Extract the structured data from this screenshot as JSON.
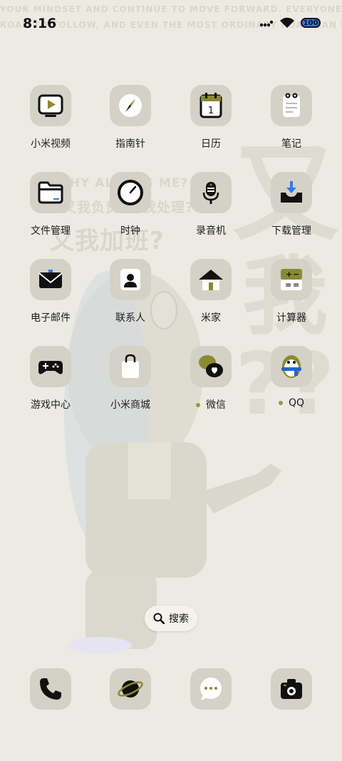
{
  "status_bar": {
    "time": "8:16",
    "battery": "100"
  },
  "wallpaper": {
    "lines": [
      "YOUR MINDSET AND CONTINUE TO MOVE FORWARD. EVERYONE HAS A",
      "ROAD TO FOLLOW, AND EVEN THE MOST ORDINARY ROAD CAN LEAD",
      "WHY ALWAYS ME?",
      "又我负责?又我处理?",
      "又我加班?"
    ],
    "big": [
      "又",
      "我",
      "?",
      "?"
    ]
  },
  "apps": [
    {
      "label": "小米视频",
      "icon": "video-play-icon"
    },
    {
      "label": "指南针",
      "icon": "compass-icon"
    },
    {
      "label": "日历",
      "icon": "calendar-icon",
      "badge": "1"
    },
    {
      "label": "笔记",
      "icon": "notes-icon"
    },
    {
      "label": "文件管理",
      "icon": "folder-icon"
    },
    {
      "label": "时钟",
      "icon": "clock-icon"
    },
    {
      "label": "录音机",
      "icon": "microphone-icon"
    },
    {
      "label": "下载管理",
      "icon": "download-icon"
    },
    {
      "label": "电子邮件",
      "icon": "mail-icon"
    },
    {
      "label": "联系人",
      "icon": "contacts-icon"
    },
    {
      "label": "米家",
      "icon": "home-icon"
    },
    {
      "label": "计算器",
      "icon": "calculator-icon"
    },
    {
      "label": "游戏中心",
      "icon": "gamepad-icon"
    },
    {
      "label": "小米商城",
      "icon": "shopping-bag-icon"
    },
    {
      "label": "微信",
      "icon": "wechat-icon",
      "dot": true
    },
    {
      "label": "QQ",
      "icon": "qq-penguin-icon",
      "dot": true
    }
  ],
  "search": {
    "label": "搜索"
  },
  "dock": [
    {
      "icon": "phone-icon"
    },
    {
      "icon": "browser-planet-icon"
    },
    {
      "icon": "messages-icon"
    },
    {
      "icon": "camera-icon"
    }
  ]
}
